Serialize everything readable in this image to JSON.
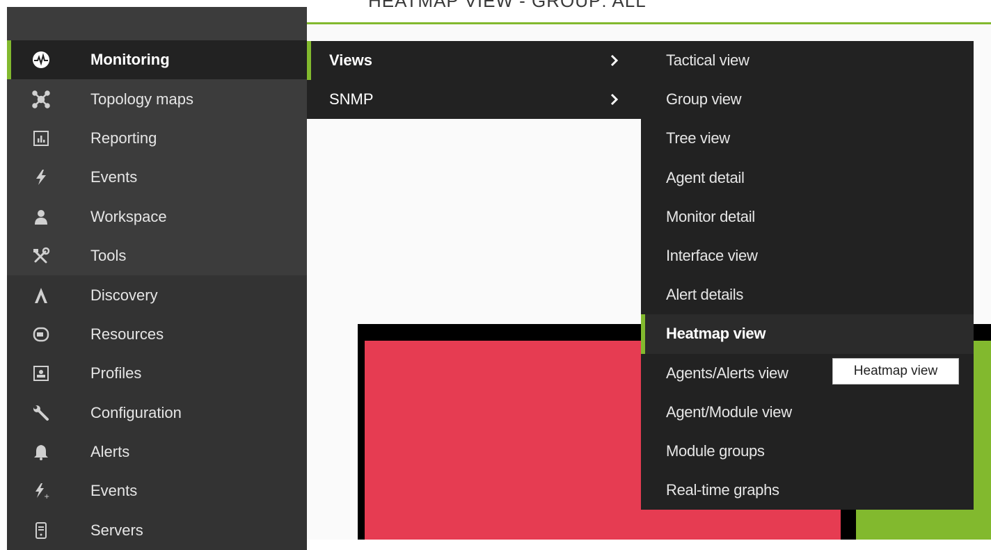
{
  "header": {
    "title": "HEATMAP VIEW - GROUP: ALL"
  },
  "colors": {
    "accent": "#82b92e",
    "critical": "#e63c52",
    "normal": "#82b92e",
    "sidebar": "#3c3c3c",
    "menu": "#222222"
  },
  "sidebar": {
    "items": [
      {
        "label": "Monitoring",
        "icon": "monitoring-pulse-icon",
        "active": true
      },
      {
        "label": "Topology maps",
        "icon": "topology-icon"
      },
      {
        "label": "Reporting",
        "icon": "chart-icon"
      },
      {
        "label": "Events",
        "icon": "lightning-icon"
      },
      {
        "label": "Workspace",
        "icon": "user-icon"
      },
      {
        "label": "Tools",
        "icon": "tools-icon"
      },
      {
        "label": "Discovery",
        "icon": "discovery-icon"
      },
      {
        "label": "Resources",
        "icon": "resources-icon"
      },
      {
        "label": "Profiles",
        "icon": "profile-icon"
      },
      {
        "label": "Configuration",
        "icon": "wrench-icon"
      },
      {
        "label": "Alerts",
        "icon": "bell-icon"
      },
      {
        "label": "Events",
        "icon": "lightning-plus-icon"
      },
      {
        "label": "Servers",
        "icon": "server-icon"
      }
    ]
  },
  "submenu": {
    "items": [
      {
        "label": "Views",
        "active": true
      },
      {
        "label": "SNMP"
      }
    ]
  },
  "views_menu": {
    "items": [
      {
        "label": "Tactical view"
      },
      {
        "label": "Group view"
      },
      {
        "label": "Tree view"
      },
      {
        "label": "Agent detail"
      },
      {
        "label": "Monitor detail"
      },
      {
        "label": "Interface view"
      },
      {
        "label": "Alert details"
      },
      {
        "label": "Heatmap view",
        "active": true
      },
      {
        "label": "Agents/Alerts view"
      },
      {
        "label": "Agent/Module view"
      },
      {
        "label": "Module groups"
      },
      {
        "label": "Real-time graphs"
      }
    ]
  },
  "tooltip": {
    "text": "Heatmap view"
  }
}
